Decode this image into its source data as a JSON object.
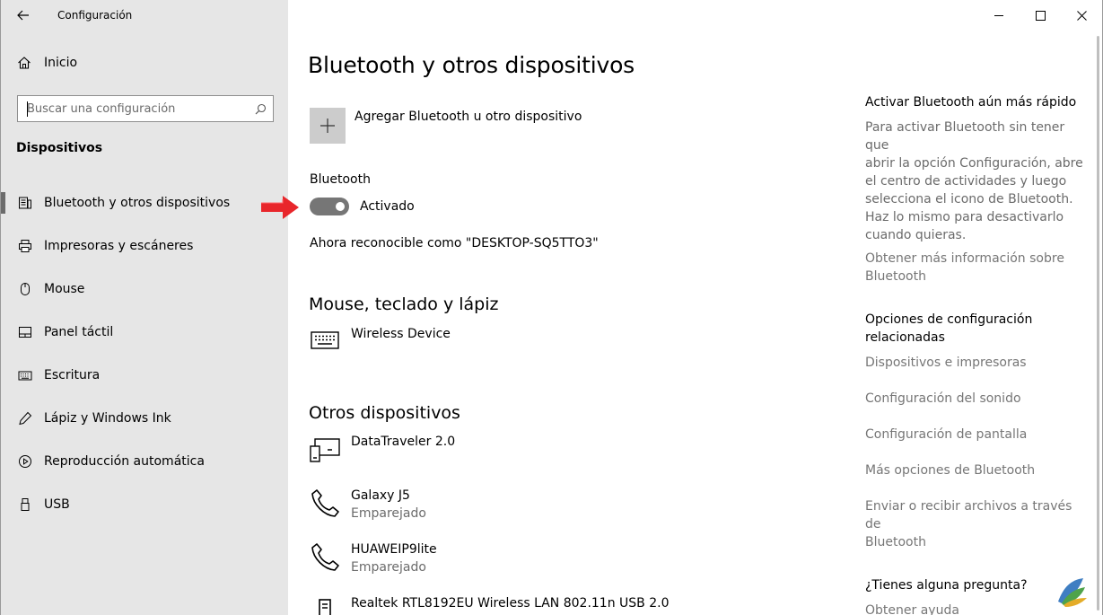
{
  "app": {
    "title": "Configuración"
  },
  "sidebar": {
    "home_label": "Inicio",
    "search_placeholder": "Buscar una configuración",
    "section_title": "Dispositivos",
    "items": [
      {
        "label": "Bluetooth y otros dispositivos",
        "icon": "bluetooth-devices-icon",
        "active": true
      },
      {
        "label": "Impresoras y escáneres",
        "icon": "printer-icon"
      },
      {
        "label": "Mouse",
        "icon": "mouse-icon"
      },
      {
        "label": "Panel táctil",
        "icon": "touchpad-icon"
      },
      {
        "label": "Escritura",
        "icon": "keyboard-icon"
      },
      {
        "label": "Lápiz y Windows Ink",
        "icon": "pen-icon"
      },
      {
        "label": "Reproducción automática",
        "icon": "autoplay-icon"
      },
      {
        "label": "USB",
        "icon": "usb-icon"
      }
    ]
  },
  "main": {
    "title": "Bluetooth y otros dispositivos",
    "add_device_label": "Agregar Bluetooth u otro dispositivo",
    "bluetooth_label": "Bluetooth",
    "toggle_state": "Activado",
    "discoverable_text": "Ahora reconocible como \"DESKTOP-SQ5TTO3\"",
    "mouse_section": {
      "title": "Mouse, teclado y lápiz",
      "devices": [
        {
          "name": "Wireless Device",
          "icon": "keyboard-icon"
        }
      ]
    },
    "other_section": {
      "title": "Otros dispositivos",
      "devices": [
        {
          "name": "DataTraveler 2.0",
          "icon": "drive-icon"
        },
        {
          "name": "Galaxy J5",
          "status": "Emparejado",
          "icon": "phone-icon"
        },
        {
          "name": "HUAWEIP9lite",
          "status": "Emparejado",
          "icon": "phone-icon"
        },
        {
          "name": "Realtek RTL8192EU Wireless LAN 802.11n USB 2.0",
          "icon": "network-adapter-icon"
        }
      ]
    }
  },
  "right": {
    "quick_title": "Activar Bluetooth aún más rápido",
    "quick_text_lines": [
      "Para activar Bluetooth sin tener que",
      "abrir la opción Configuración, abre",
      "el centro de actividades y luego",
      "selecciona el icono de Bluetooth.",
      "Haz lo mismo para desactivarlo",
      "cuando quieras."
    ],
    "more_info_lines": [
      "Obtener más información sobre",
      "Bluetooth"
    ],
    "related_title_lines": [
      "Opciones de configuración",
      "relacionadas"
    ],
    "related_links": {
      "devices_printers": "Dispositivos e impresoras",
      "sound": "Configuración del sonido",
      "display": "Configuración de pantalla",
      "more_bt": "Más opciones de Bluetooth",
      "send_receive_lines": [
        "Enviar o recibir archivos a través de",
        "Bluetooth"
      ]
    },
    "question_title": "¿Tienes alguna pregunta?",
    "help_link": "Obtener ayuda"
  },
  "colors": {
    "accent_arrow": "#e8262b",
    "toggle_off": "#767676",
    "sidebar_bg": "#e6e6e6"
  }
}
